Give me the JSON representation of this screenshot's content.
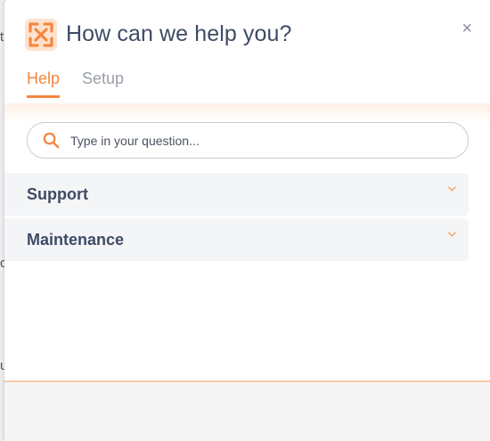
{
  "background": {
    "glyph_1": "t",
    "glyph_2": "c",
    "glyph_3": "u"
  },
  "widget": {
    "title": "How can we help you?",
    "close_symbol": "×",
    "logo_icon": "brand-logo-icon"
  },
  "tabs": [
    {
      "label": "Help",
      "active": true
    },
    {
      "label": "Setup",
      "active": false
    }
  ],
  "search": {
    "placeholder": "Type in your question...",
    "value": ""
  },
  "categories": [
    {
      "label": "Support"
    },
    {
      "label": "Maintenance"
    }
  ],
  "colors": {
    "accent": "#f5863f",
    "title": "#3f4b66",
    "muted": "#9aa0a8"
  }
}
